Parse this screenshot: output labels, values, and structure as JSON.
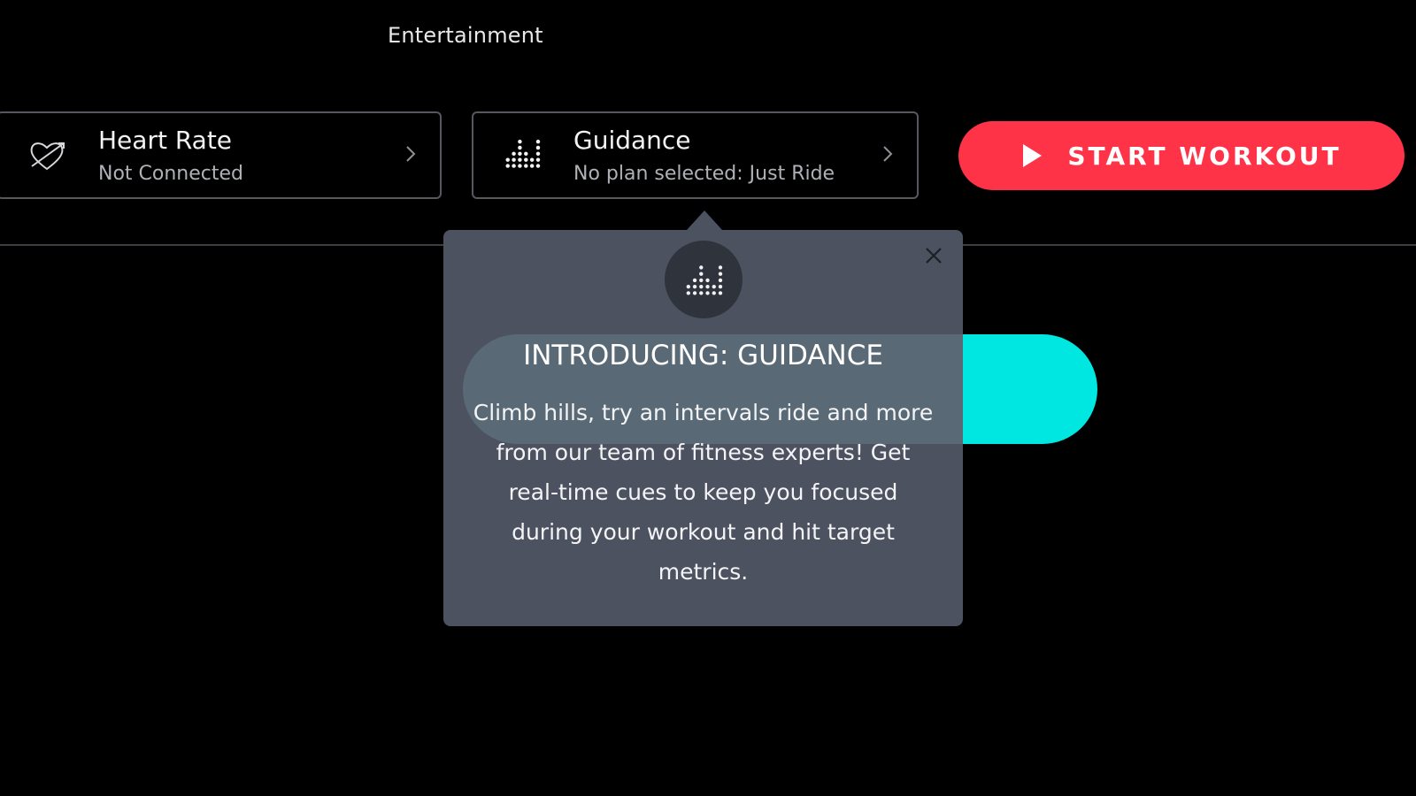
{
  "section": {
    "label": "Entertainment"
  },
  "heart_rate": {
    "title": "Heart Rate",
    "status": "Not Connected",
    "icon": "heart-disconnected-icon"
  },
  "guidance": {
    "title": "Guidance",
    "status": "No plan selected: Just Ride",
    "icon": "guidance-bars-icon"
  },
  "start_button": {
    "label": "START WORKOUT",
    "icon": "play-icon",
    "color": "#ff3347"
  },
  "popover": {
    "title": "INTRODUCING: GUIDANCE",
    "body": "Climb hills, try an intervals ride and more from our team of fitness experts! Get real-time cues to keep you focused during your workout and hit target metrics.",
    "background": "#4c5260",
    "icon": "guidance-bars-icon",
    "close_icon": "close-icon"
  },
  "accent_colors": {
    "cyan": "#00e6e0",
    "red": "#ff3347"
  }
}
